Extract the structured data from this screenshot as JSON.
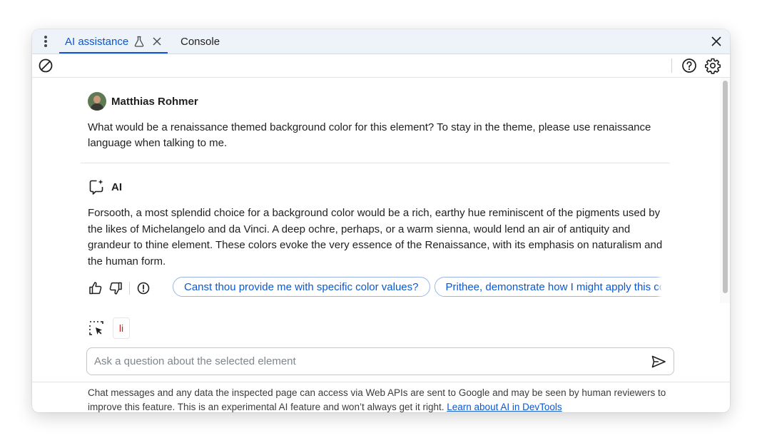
{
  "tabs": [
    {
      "label": "AI assistance",
      "active": true,
      "icon": "flask-icon",
      "closable": true
    },
    {
      "label": "Console",
      "active": false
    }
  ],
  "toolbar": {
    "clear_icon": "clear-chat-icon",
    "help_icon": "help-icon",
    "settings_icon": "gear-icon"
  },
  "conversation": {
    "user": {
      "name": "Matthias Rohmer",
      "message": "What would be a renaissance themed background color for this element? To stay in the theme, please use renaissance language when talking to me."
    },
    "ai": {
      "name": "AI",
      "message": "Forsooth, a most splendid choice for a background color would be a rich, earthy hue reminiscent of the pigments used by the likes of Michelangelo and da Vinci. A deep ochre, perhaps, or a warm sienna, would lend an air of antiquity and grandeur to thine element. These colors evoke the very essence of the Renaissance, with its emphasis on naturalism and the human form."
    },
    "suggestions": [
      "Canst thou provide me with specific color values?",
      "Prithee, demonstrate how I might apply this color"
    ]
  },
  "context": {
    "selected_element": "li"
  },
  "input": {
    "placeholder": "Ask a question about the selected element",
    "value": ""
  },
  "footer": {
    "disclaimer": "Chat messages and any data the inspected page can access via Web APIs are sent to Google and may be seen by human reviewers to improve this feature. This is an experimental AI feature and won’t always get it right.",
    "link_text": "Learn about AI in DevTools"
  },
  "colors": {
    "accent": "#0b57d0",
    "element_tag": "#c5221f",
    "tab_strip_bg": "#eef2f9"
  }
}
